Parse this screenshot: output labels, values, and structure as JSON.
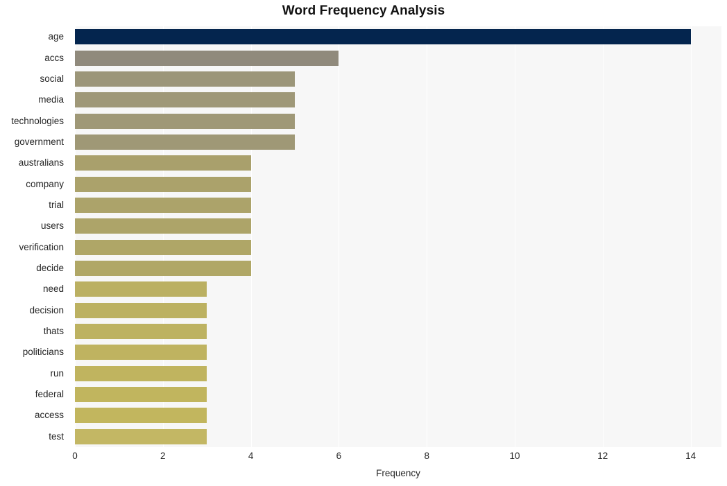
{
  "chart_data": {
    "type": "bar",
    "orientation": "horizontal",
    "title": "Word Frequency Analysis",
    "xlabel": "Frequency",
    "ylabel": "",
    "categories": [
      "age",
      "accs",
      "social",
      "media",
      "technologies",
      "government",
      "australians",
      "company",
      "trial",
      "users",
      "verification",
      "decide",
      "need",
      "decision",
      "thats",
      "politicians",
      "run",
      "federal",
      "access",
      "test"
    ],
    "values": [
      14,
      6,
      5,
      5,
      5,
      5,
      4,
      4,
      4,
      4,
      4,
      4,
      3,
      3,
      3,
      3,
      3,
      3,
      3,
      3
    ],
    "bar_colors": [
      "#04254e",
      "#908a7c",
      "#9c9679",
      "#9f9878",
      "#9f9877",
      "#9f9876",
      "#a9a06c",
      "#aba26b",
      "#aca36a",
      "#ada469",
      "#afa667",
      "#b0a766",
      "#bbb062",
      "#bcb161",
      "#bdb261",
      "#bfb360",
      "#c0b45f",
      "#c1b55e",
      "#c2b65e",
      "#c3b764"
    ],
    "xticks": [
      "0",
      "2",
      "4",
      "6",
      "8",
      "10",
      "12",
      "14"
    ],
    "xtick_values": [
      0,
      2,
      4,
      6,
      8,
      10,
      12,
      14
    ],
    "xlim": [
      0,
      14.7
    ],
    "grid": true,
    "gridlines": "vertical-white",
    "legend": "none",
    "plot_background": "#f7f7f7",
    "figure_background": "#ffffff",
    "title_color": "#121212",
    "tick_color": "#262626"
  }
}
